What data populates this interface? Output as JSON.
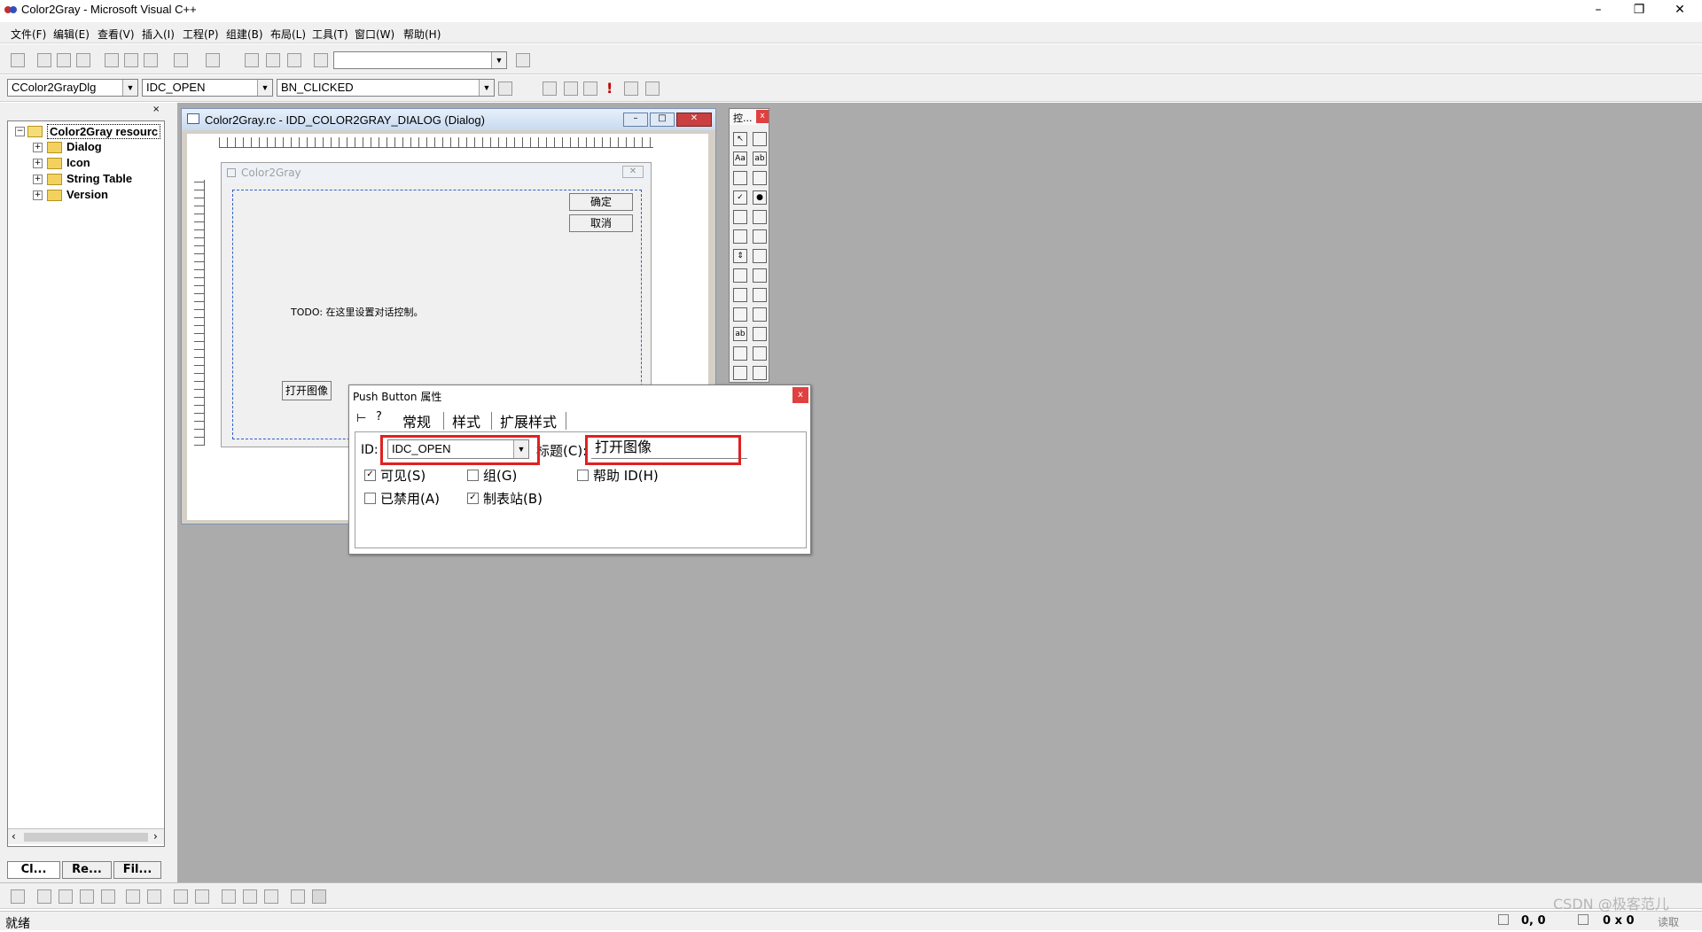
{
  "window": {
    "title": "Color2Gray - Microsoft Visual C++"
  },
  "menu": [
    "文件(F)",
    "编辑(E)",
    "查看(V)",
    "插入(I)",
    "工程(P)",
    "组建(B)",
    "布局(L)",
    "工具(T)",
    "窗口(W)",
    "帮助(H)"
  ],
  "wizardbar": {
    "class": "CColor2GrayDlg",
    "id": "IDC_OPEN",
    "message": "BN_CLICKED"
  },
  "tree": {
    "root": "Color2Gray resourc",
    "items": [
      "Dialog",
      "Icon",
      "String Table",
      "Version"
    ]
  },
  "workspace_tabs": [
    "Cl...",
    "Re...",
    "Fil..."
  ],
  "editor": {
    "title": "Color2Gray.rc - IDD_COLOR2GRAY_DIALOG (Dialog)",
    "dialog_title": "Color2Gray",
    "ok_label": "确定",
    "cancel_label": "取消",
    "todo_text": "TODO: 在这里设置对话控制。",
    "open_button_label": "打开图像"
  },
  "controls_palette": {
    "title": "控..."
  },
  "properties": {
    "title": "Push Button 属性",
    "tabs": [
      "常规",
      "样式",
      "扩展样式"
    ],
    "id_label": "ID:",
    "id_value": "IDC_OPEN",
    "caption_label": "标题(C):",
    "caption_value": "打开图像",
    "checkboxes": [
      {
        "label": "可见(S)",
        "checked": true
      },
      {
        "label": "组(G)",
        "checked": false
      },
      {
        "label": "帮助 ID(H)",
        "checked": false
      },
      {
        "label": "已禁用(A)",
        "checked": false
      },
      {
        "label": "制表站(B)",
        "checked": true
      }
    ]
  },
  "status": {
    "text": "就绪",
    "position": "0, 0",
    "size": "0 x 0",
    "watermark": "CSDN @极客范儿",
    "mode": "读取"
  },
  "colors": {
    "highlight": "#e02020",
    "mdi_background": "#ababab"
  }
}
